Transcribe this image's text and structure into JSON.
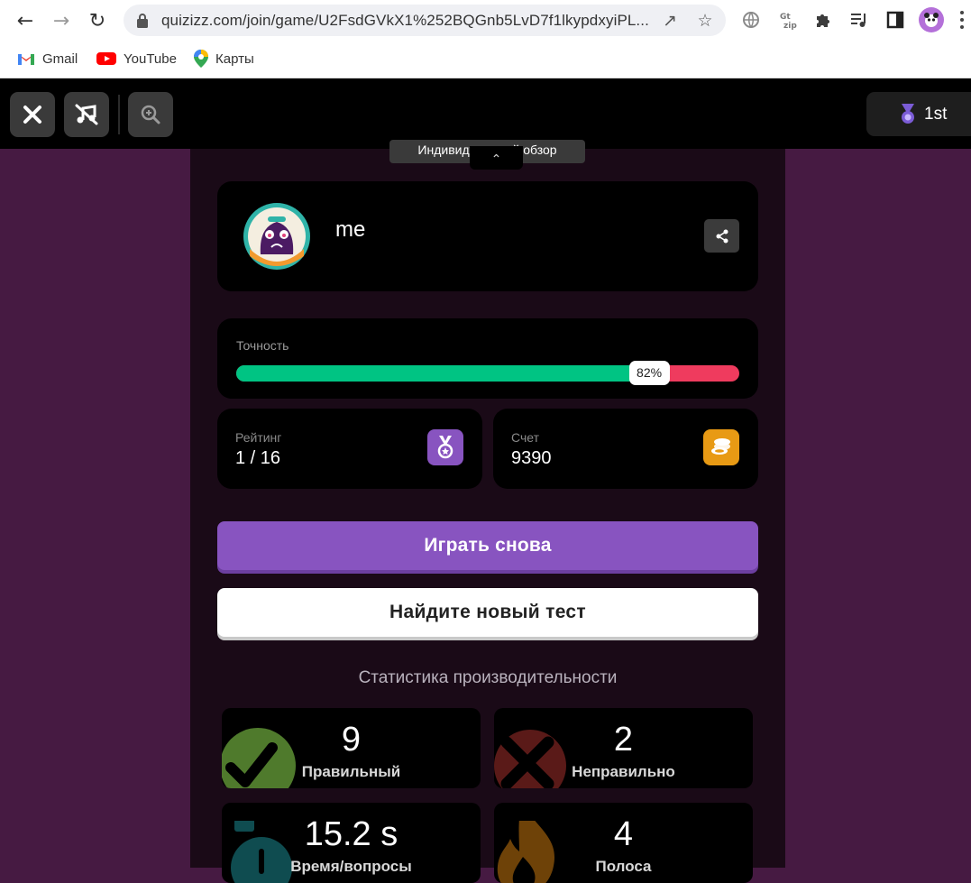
{
  "browser": {
    "url": "quizizz.com/join/game/U2FsdGVkX1%252BQGnb5LvD7f1lkypdxyiPL...",
    "nav": {
      "back_icon": "back-arrow-icon",
      "forward_icon": "forward-arrow-icon",
      "reload_icon": "reload-icon"
    },
    "bookmarks": [
      {
        "label": "Gmail",
        "icon": "gmail-icon"
      },
      {
        "label": "YouTube",
        "icon": "youtube-icon"
      },
      {
        "label": "Карты",
        "icon": "maps-pin-icon"
      }
    ]
  },
  "app_bar": {
    "rank_label": "1st"
  },
  "review_tab": {
    "label": "Индивидуальный обзор"
  },
  "player": {
    "name": "me"
  },
  "accuracy": {
    "label": "Точность",
    "percent_text": "82%",
    "value": 82,
    "colors": {
      "correct": "#00c483",
      "incorrect": "#ef3b5e"
    }
  },
  "rating": {
    "label": "Рейтинг",
    "value": "1 / 16",
    "icon_color": "#8854c0"
  },
  "score": {
    "label": "Счет",
    "value": "9390",
    "icon_color": "#e89a14"
  },
  "actions": {
    "play_again": "Играть снова",
    "find_new_test": "Найдите новый тест"
  },
  "performance": {
    "heading": "Статистика производительности",
    "tiles": [
      {
        "value": "9",
        "label": "Правильный",
        "icon": "checkmark-icon"
      },
      {
        "value": "2",
        "label": "Неправильно",
        "icon": "cross-icon"
      },
      {
        "value": "15.2 s",
        "label": "Время/вопросы",
        "icon": "stopwatch-icon"
      },
      {
        "value": "4",
        "label": "Полоса",
        "icon": "flame-icon"
      }
    ]
  }
}
